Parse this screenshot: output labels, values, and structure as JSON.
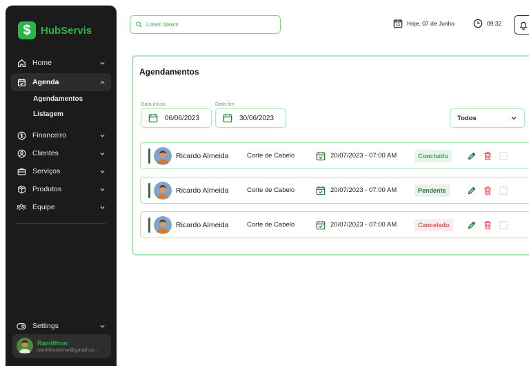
{
  "app": {
    "logo_glyph": "$",
    "name": "HubServis"
  },
  "sidebar": {
    "items": [
      {
        "label": "Home",
        "icon": "home-icon"
      },
      {
        "label": "Agenda",
        "icon": "calendar-check-icon",
        "active": true,
        "children": [
          {
            "label": "Agendamentos"
          },
          {
            "label": "Listagem"
          }
        ]
      },
      {
        "label": "Financeiro",
        "icon": "dollar-icon"
      },
      {
        "label": "Clientes",
        "icon": "user-circle-icon"
      },
      {
        "label": "Serviços",
        "icon": "briefcase-icon"
      },
      {
        "label": "Produtos",
        "icon": "box-icon"
      },
      {
        "label": "Equipe",
        "icon": "team-icon"
      }
    ],
    "settings": {
      "label": "Settings",
      "icon": "toggle-icon"
    },
    "user": {
      "name": "Ramilthon",
      "email": "ramilthonbmw@gmail.co..."
    }
  },
  "topbar": {
    "search_value": "Lorem Ipsum",
    "date_badge": "12",
    "date_text": "Hoje, 07 de Junho",
    "time_text": "09:32"
  },
  "main": {
    "title": "Agendamentos",
    "filters": {
      "start_label": "Data início",
      "start_value": "06/06/2023",
      "end_label": "Data fim",
      "end_value": "30/06/2023",
      "status_value": "Todos"
    },
    "appointments": [
      {
        "client": "Ricardo Almeida",
        "service": "Corte de Cabelo",
        "datetime": "20/07/2023 - 07:00 AM",
        "status": "Concluído",
        "status_color": "#2db34a",
        "status_bg": "#e8f5ea"
      },
      {
        "client": "Ricardo Almeida",
        "service": "Corte de Cabelo",
        "datetime": "20/07/2023 - 07:00 AM",
        "status": "Pendente",
        "status_color": "#1f7a35",
        "status_bg": "#eef0ee"
      },
      {
        "client": "Ricardo Almeida",
        "service": "Corte de Cabelo",
        "datetime": "20/07/2023 - 07:00 AM",
        "status": "Cancelado",
        "status_color": "#e25555",
        "status_bg": "#f5eeee"
      }
    ]
  },
  "colors": {
    "brand": "#2db34a",
    "sidebar_bg": "#1b1b1b",
    "border": "#a9e8b6",
    "danger": "#e25555"
  }
}
